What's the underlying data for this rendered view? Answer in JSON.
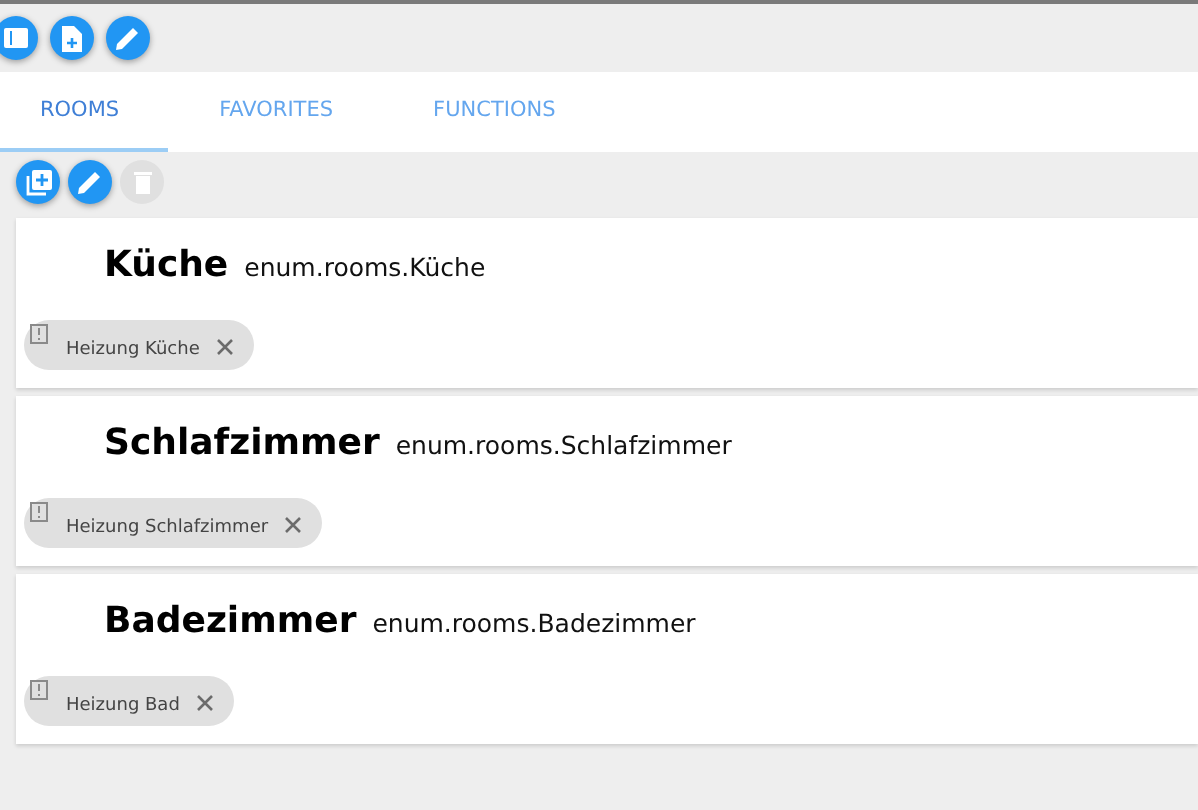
{
  "top_toolbar": [
    {
      "kind": "panel",
      "disabled": false
    },
    {
      "kind": "new-file",
      "disabled": false
    },
    {
      "kind": "edit",
      "disabled": false
    }
  ],
  "tabs": [
    {
      "label": "ROOMS",
      "selected": true
    },
    {
      "label": "FAVORITES",
      "selected": false
    },
    {
      "label": "FUNCTIONS",
      "selected": false
    }
  ],
  "room_toolbar": [
    {
      "kind": "add",
      "disabled": false
    },
    {
      "kind": "edit",
      "disabled": false
    },
    {
      "kind": "delete",
      "disabled": true
    }
  ],
  "rooms": [
    {
      "name": "Küche",
      "id": "enum.rooms.Küche",
      "members": [
        {
          "label": "Heizung Küche"
        }
      ]
    },
    {
      "name": "Schlafzimmer",
      "id": "enum.rooms.Schlafzimmer",
      "members": [
        {
          "label": "Heizung Schlafzimmer"
        }
      ]
    },
    {
      "name": "Badezimmer",
      "id": "enum.rooms.Badezimmer",
      "members": [
        {
          "label": "Heizung Bad"
        }
      ]
    }
  ]
}
